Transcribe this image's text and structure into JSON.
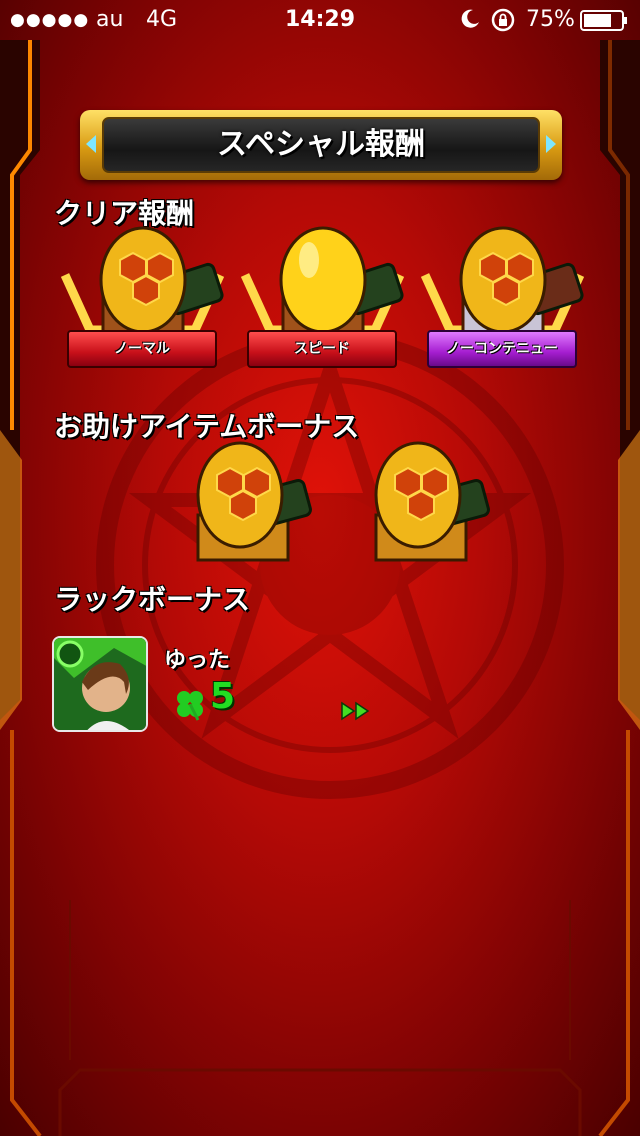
{
  "status_bar": {
    "signal_dots": "●●●●●",
    "carrier": "au",
    "network": "4G",
    "time": "14:29",
    "battery_percent": "75%",
    "icons": [
      "moon-icon",
      "rotation-lock-icon",
      "battery-icon"
    ],
    "battery_level": 0.75
  },
  "title": "スペシャル報酬",
  "sections": {
    "clear_rewards": "クリア報酬",
    "helper_item_bonus": "お助けアイテムボーナス",
    "luck_bonus": "ラックボーナス"
  },
  "clear_rewards": [
    {
      "label": "ノーマル",
      "ribbon": "red",
      "egg": "honeycomb"
    },
    {
      "label": "スピード",
      "ribbon": "red",
      "egg": "plain-gold"
    },
    {
      "label": "ノーコンテニュー",
      "ribbon": "purple",
      "egg": "honeycomb"
    }
  ],
  "helper_item_bonus": [
    {
      "egg": "honeycomb"
    },
    {
      "egg": "honeycomb"
    }
  ],
  "luck_bonus": {
    "player_name": "ゆった",
    "luck": "5",
    "icons": [
      "clover-icon",
      "fast-forward-icon"
    ]
  },
  "colors": {
    "background": "#b50a06",
    "gold": "#e6b422",
    "ribbon_red": "#c8101a",
    "ribbon_purple": "#a51ed0",
    "luck_green": "#22dd22",
    "accent_cyan": "#7ee6ff"
  }
}
